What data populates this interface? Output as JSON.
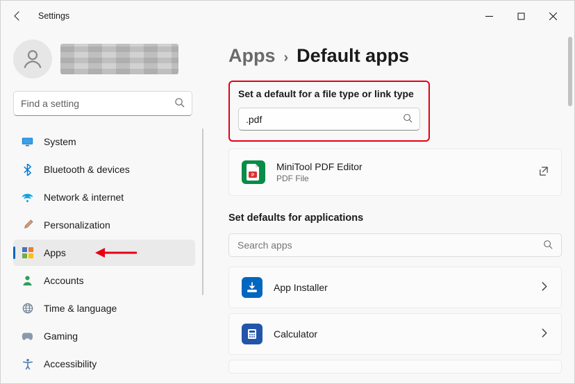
{
  "window": {
    "title": "Settings"
  },
  "profile": {
    "name_hidden": true
  },
  "sidebar_search": {
    "placeholder": "Find a setting",
    "value": ""
  },
  "nav": [
    {
      "id": "system",
      "label": "System",
      "icon": "monitor-icon",
      "color": "#0067c0"
    },
    {
      "id": "bluetooth",
      "label": "Bluetooth & devices",
      "icon": "bluetooth-icon",
      "color": "#0067c0"
    },
    {
      "id": "network",
      "label": "Network & internet",
      "icon": "wifi-icon",
      "color": "#00a3e0"
    },
    {
      "id": "personalization",
      "label": "Personalization",
      "icon": "brush-icon",
      "color": "#8a6457"
    },
    {
      "id": "apps",
      "label": "Apps",
      "icon": "apps-icon",
      "color": "#5b5b5b",
      "active": true
    },
    {
      "id": "accounts",
      "label": "Accounts",
      "icon": "person-icon",
      "color": "#2e9e5b"
    },
    {
      "id": "time",
      "label": "Time & language",
      "icon": "globe-icon",
      "color": "#6b7d8f"
    },
    {
      "id": "gaming",
      "label": "Gaming",
      "icon": "gamepad-icon",
      "color": "#6b7d8f"
    },
    {
      "id": "accessibility",
      "label": "Accessibility",
      "icon": "accessibility-icon",
      "color": "#4b7bb5"
    }
  ],
  "breadcrumb": {
    "parent": "Apps",
    "title": "Default apps"
  },
  "file_type_section": {
    "heading": "Set a default for a file type or link type",
    "search_value": ".pdf",
    "result": {
      "app_name": "MiniTool PDF Editor",
      "subtitle": "PDF File"
    }
  },
  "apps_section": {
    "heading": "Set defaults for applications",
    "search_placeholder": "Search apps",
    "apps": [
      {
        "name": "App Installer",
        "icon": "app-installer-icon"
      },
      {
        "name": "Calculator",
        "icon": "calculator-icon"
      }
    ]
  }
}
